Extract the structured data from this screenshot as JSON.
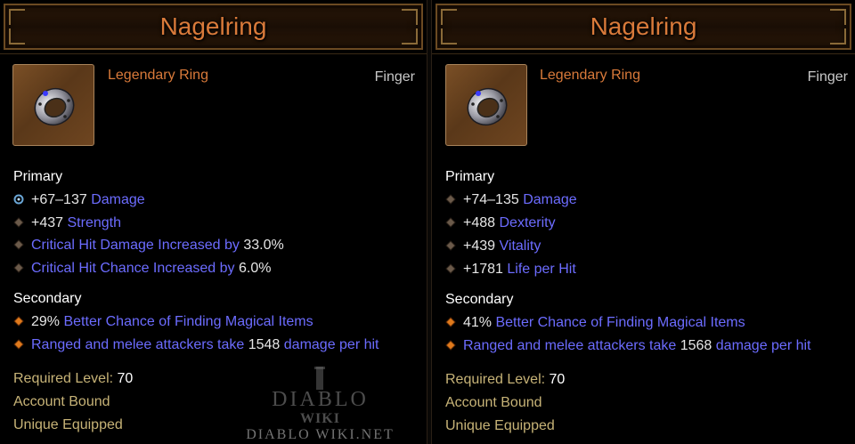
{
  "left": {
    "name": "Nagelring",
    "item_type": "Legendary Ring",
    "slot": "Finger",
    "icon": "ring-icon",
    "primary_label": "Primary",
    "primary": [
      {
        "bullet": "gem-socket-icon",
        "num": "+67–137",
        "txt": "Damage"
      },
      {
        "bullet": "diamond-bullet-icon",
        "num": "+437",
        "txt": "Strength"
      },
      {
        "bullet": "diamond-bullet-icon",
        "pre": "Critical Hit Damage Increased by",
        "num": "33.0%"
      },
      {
        "bullet": "diamond-bullet-icon",
        "pre": "Critical Hit Chance Increased by",
        "num": "6.0%"
      }
    ],
    "secondary_label": "Secondary",
    "secondary": [
      {
        "bullet": "orange-diamond-icon",
        "num": "29%",
        "txt": "Better Chance of Finding Magical Items"
      },
      {
        "bullet": "orange-diamond-icon",
        "pre": "Ranged and melee attackers take",
        "num": "1548",
        "txt": "damage per hit"
      }
    ],
    "required_level_label": "Required Level:",
    "required_level": "70",
    "account_bound": "Account Bound",
    "unique_equipped": "Unique Equipped"
  },
  "right": {
    "name": "Nagelring",
    "item_type": "Legendary Ring",
    "slot": "Finger",
    "icon": "ring-icon",
    "primary_label": "Primary",
    "primary": [
      {
        "bullet": "diamond-bullet-icon",
        "num": "+74–135",
        "txt": "Damage"
      },
      {
        "bullet": "diamond-bullet-icon",
        "num": "+488",
        "txt": "Dexterity"
      },
      {
        "bullet": "diamond-bullet-icon",
        "num": "+439",
        "txt": "Vitality"
      },
      {
        "bullet": "diamond-bullet-icon",
        "num": "+1781",
        "txt": "Life per Hit"
      }
    ],
    "secondary_label": "Secondary",
    "secondary": [
      {
        "bullet": "orange-diamond-icon",
        "num": "41%",
        "txt": "Better Chance of Finding Magical Items"
      },
      {
        "bullet": "orange-diamond-icon",
        "pre": "Ranged and melee attackers take",
        "num": "1568",
        "txt": "damage per hit"
      }
    ],
    "required_level_label": "Required Level:",
    "required_level": "70",
    "account_bound": "Account Bound",
    "unique_equipped": "Unique Equipped"
  },
  "watermark": {
    "line1": "DIABLO",
    "line2": "WIKI",
    "url": "DIABLO WIKI.NET"
  },
  "colors": {
    "title": "#d97a3a",
    "stat_text": "#6c6cff",
    "stat_number": "#e6e6e6",
    "footer": "#c7b377"
  }
}
